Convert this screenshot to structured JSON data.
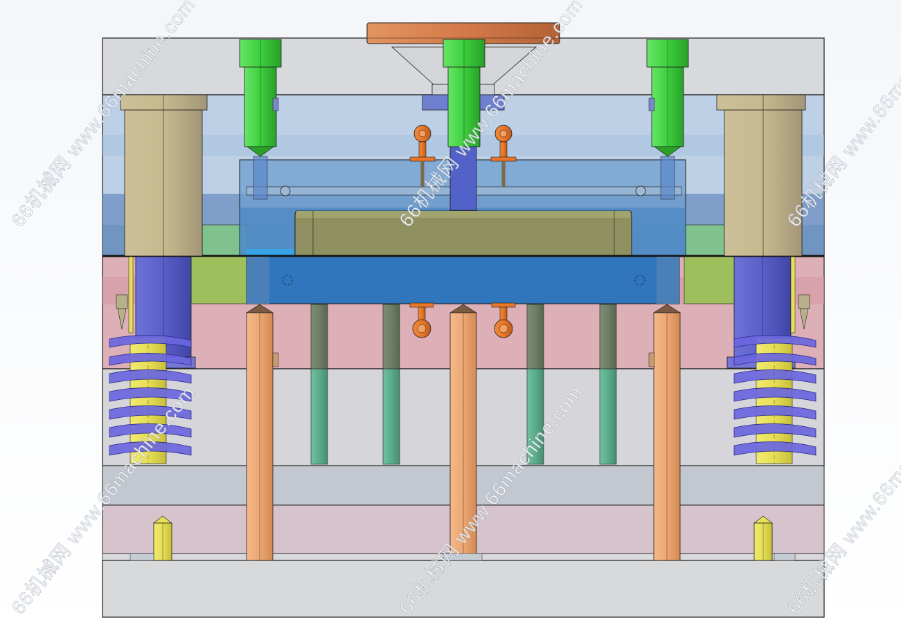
{
  "watermark": {
    "text": "66机械网 www.66machine.com"
  },
  "colors": {
    "background": "#f6f8fb",
    "top_clamp_plate": "#d5d7da",
    "a_plate": "#b9cde5",
    "b_plate": "#d9a9b0",
    "cavity": "#6e9ecf",
    "core_insert": "#8e9060",
    "ejector_pin": "#eda772",
    "guide_pin": "#5a5fc8",
    "guide_bushing": "#c7b98d",
    "spring": "#6a66e0",
    "return_pin": "#7a8a70",
    "bolt": "#3ccf3c",
    "sprue_bushing": "#d47a4a",
    "slide_block": "#2f76bd",
    "support_pillar": "#e7df55",
    "lifter_pin": "#5bab8c",
    "outline": "#1c1c1c"
  }
}
